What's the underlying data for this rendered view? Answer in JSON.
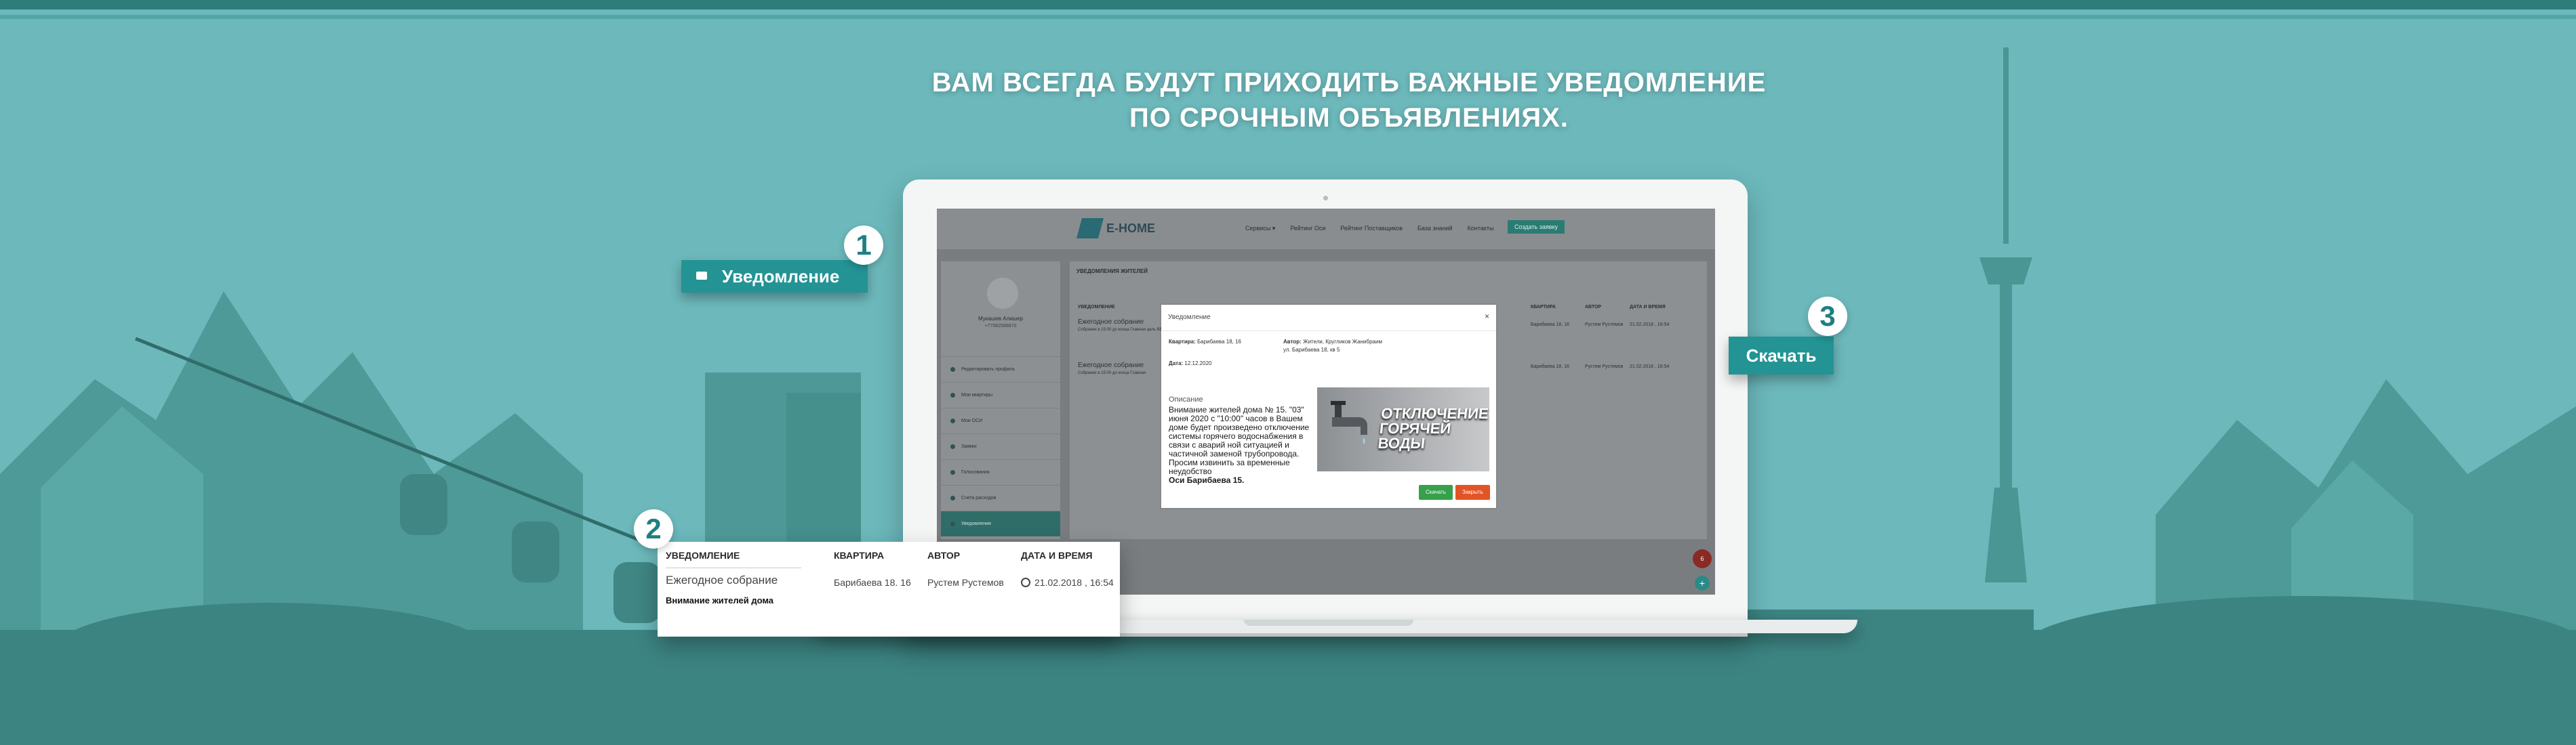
{
  "headline": {
    "line1": "ВАМ ВСЕГДА БУДУТ ПРИХОДИТЬ ВАЖНЫЕ УВЕДОМЛЕНИЕ",
    "line2": "ПО СРОЧНЫМ ОБЪЯВЛЕНИЯХ."
  },
  "callouts": {
    "badge1": "1",
    "label1": "Уведомление",
    "badge2": "2",
    "badge3": "3",
    "label3": "Скачать"
  },
  "app": {
    "logo": "E-HOME",
    "nav": [
      "Сервисы ▾",
      "Рейтинг Оси",
      "Рейтинг Поставщиков",
      "База знаний",
      "Контакты"
    ],
    "nav_button": "Создать заявку",
    "profile": {
      "name": "Мукашев Алишер",
      "id": "+77082588870"
    },
    "menu": [
      "Редактировать профиль",
      "Мои квартиры",
      "Мои ОСИ",
      "Заявки",
      "Голосования",
      "Счета расходов",
      "Уведомления"
    ],
    "content_title": "УВЕДОМЛЕНИЯ ЖИТЕЛЕЙ",
    "columns": [
      "УВЕДОМЛЕНИЕ",
      "КВАРТИРА",
      "АВТОР",
      "ДАТА И ВРЕМЯ"
    ],
    "rows": [
      {
        "title": "Ежегодное собрание",
        "sub": "Собрание в 15:00 до конца Главная цель ВВВВ",
        "apt": "Барибаева 18, 16",
        "author": "Рустем Рустемов",
        "date": "21.02.2018 , 16:54"
      },
      {
        "title": "Ежегодное собрание",
        "sub": "Собрание в 15:00 до конца Главная",
        "apt": "Барибаева 18, 16",
        "author": "Рустем Рустемов",
        "date": "21.02.2018 , 16:54"
      }
    ],
    "fab_red": "6",
    "fab_teal": "+"
  },
  "modal": {
    "title": "Уведомление",
    "close": "×",
    "apt_label": "Квартира:",
    "apt_value": "Барибаева 18, 16",
    "author_label": "Автор:",
    "author_value": "Жители, Кругликов Жанибраим",
    "author_addr": "ул. Барибаева 18, кв 5",
    "date_label": "Дата:",
    "date_value": "12.12.2020",
    "desc_label": "Описание",
    "desc_text": "Внимание жителей дома № 15. \"03\" июня 2020 с \"10:00\" часов в Вашем доме будет произведено отключение системы горячего водоснабжения в связи с аварий ной ситуацией и частичной заменой трубопровода. Просим извинить за временные неудобство",
    "desc_sign": "Оси Барибаева 15.",
    "banner_text": "ОТКЛЮЧЕНИЕ ГОРЯЧЕЙ ВОДЫ",
    "btn_download": "Скачать",
    "btn_close": "Закрыть"
  },
  "card": {
    "columns": [
      "УВЕДОМЛЕНИЕ",
      "КВАРТИРА",
      "АВТОР",
      "ДАТА И ВРЕМЯ"
    ],
    "title": "Ежегодное собрание",
    "subtitle": "Внимание жителей дома",
    "apt": "Барибаева 18. 16",
    "author": "Рустем Рустемов",
    "date": "21.02.2018 , 16:54"
  }
}
